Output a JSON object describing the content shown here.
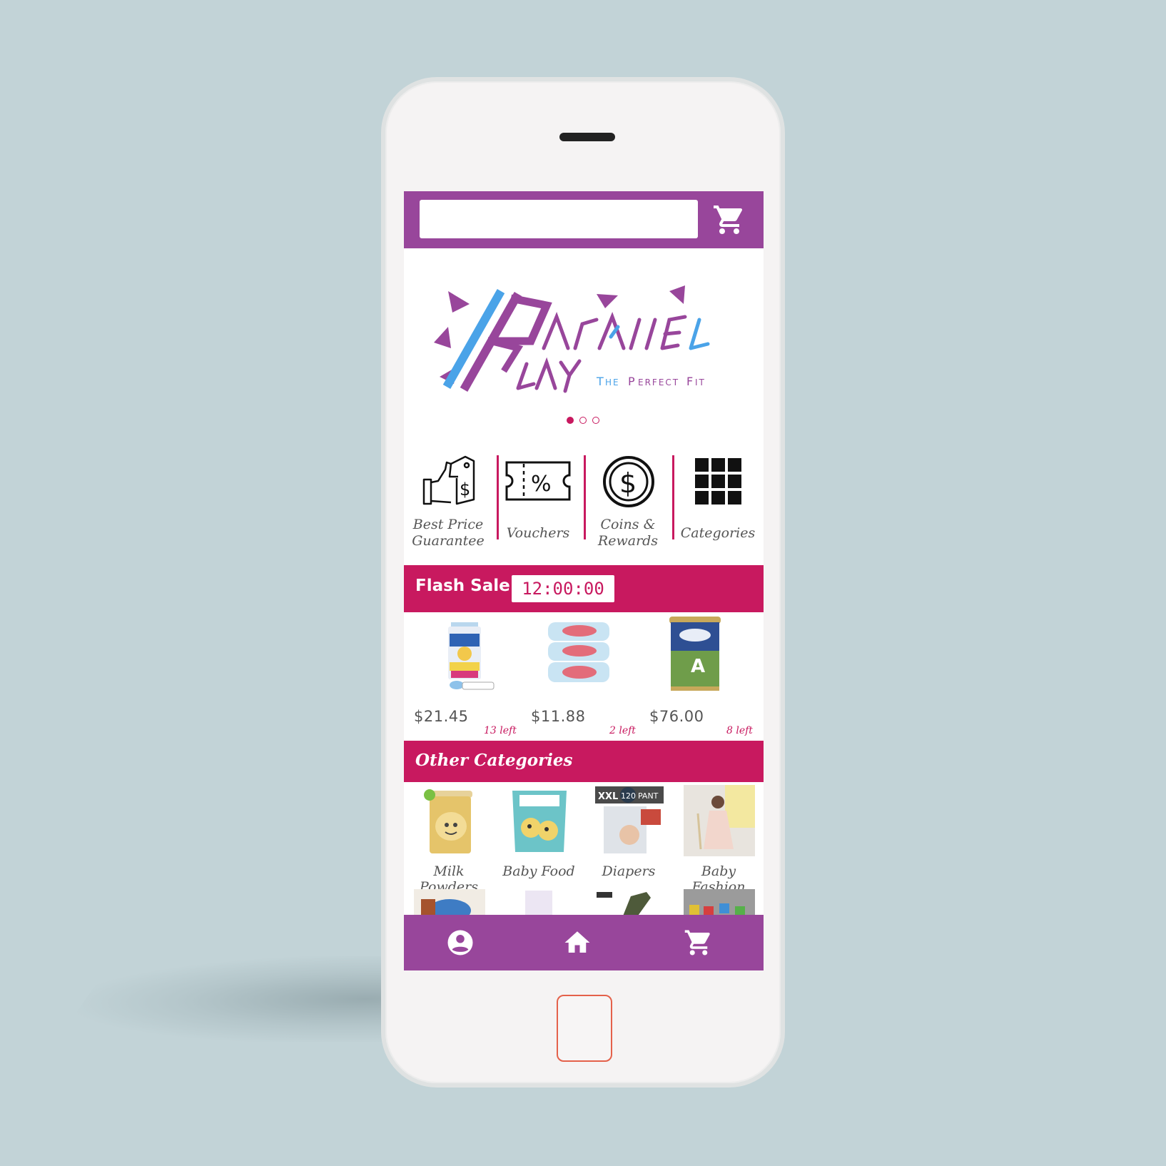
{
  "search": {
    "placeholder": ""
  },
  "icons": {
    "top_cart": "shopping-cart-icon",
    "nav_profile": "account-circle-icon",
    "nav_home": "home-icon",
    "nav_cart": "shopping-cart-icon"
  },
  "colors": {
    "brand_purple": "#98469b",
    "accent_pink": "#c8195f",
    "logo_blue": "#4aa3e8"
  },
  "banner": {
    "logo_text": "Parallel Play",
    "tagline": "The Perfect Fit",
    "slides": 3,
    "active_slide": 1
  },
  "quick_links": [
    {
      "label": "Best Price Guarantee",
      "line1": "Best Price",
      "line2": "Guarantee",
      "icon": "thumbs-up-price-tag-icon"
    },
    {
      "label": "Vouchers",
      "icon": "voucher-ticket-icon"
    },
    {
      "label": "Coins & Rewards",
      "line1": "Coins &",
      "line2": "Rewards",
      "icon": "dollar-coin-icon"
    },
    {
      "label": "Categories",
      "icon": "grid-icon"
    }
  ],
  "flash_sale": {
    "title": "Flash Sale",
    "timer": "12:00:00",
    "items": [
      {
        "price": "$21.45",
        "stock": "13 left",
        "image": "diaper-pack-image"
      },
      {
        "price": "$11.88",
        "stock": "2 left",
        "image": "baby-wipes-image"
      },
      {
        "price": "$76.00",
        "stock": "8 left",
        "image": "milk-formula-can-image"
      }
    ]
  },
  "other_categories": {
    "title": "Other Categories",
    "items": [
      {
        "label": "Milk Powders"
      },
      {
        "label": "Baby Food"
      },
      {
        "label": "Diapers"
      },
      {
        "label": "Baby Fashion"
      }
    ]
  }
}
